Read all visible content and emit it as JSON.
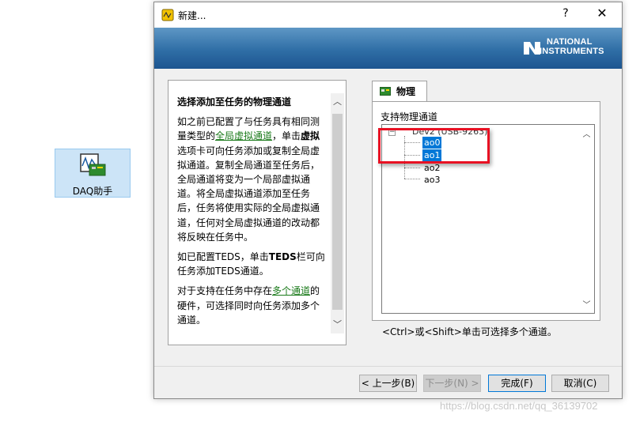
{
  "desktop": {
    "daq_label": "DAQ助手"
  },
  "dialog": {
    "title": "新建...",
    "help_glyph": "?",
    "close_glyph": "✕",
    "logo_line1": "NATIONAL",
    "logo_line2": "INSTRUMENTS"
  },
  "help_panel": {
    "heading": "选择添加至任务的物理通道",
    "p1_a": "如之前已配置了与任务具有相同测量类型的",
    "p1_link": "全局虚拟通道",
    "p1_b": "，单击",
    "p1_bold": "虚拟",
    "p1_c": "选项卡可向任务添加或复制全局虚拟通道。复制全局通道至任务后，全局通道将变为一个局部虚拟通道。将全局虚拟通道添加至任务后，任务将使用实际的全局虚拟通道，任何对全局虚拟通道的改动都将反映在任务中。",
    "p2_a": "如已配置TEDS，单击",
    "p2_bold": "TEDS",
    "p2_b": "栏可向任务添加TEDS通道。",
    "p3_a": "对于支持在任务中存在",
    "p3_link": "多个通道",
    "p3_b": "的硬件，可选择同时向任务添加多个通道。"
  },
  "tab": {
    "label": "物理"
  },
  "channels": {
    "label": "支持物理通道",
    "device": "Dev2 (USB-9263)",
    "items": [
      "ao0",
      "ao1",
      "ao2",
      "ao3"
    ],
    "selected": [
      "ao0",
      "ao1"
    ]
  },
  "hint": "<Ctrl>或<Shift>单击可选择多个通道。",
  "buttons": {
    "back": "< 上一步(B)",
    "next": "下一步(N) >",
    "finish": "完成(F)",
    "cancel": "取消(C)"
  },
  "watermark": "https://blog.csdn.net/qq_36139702"
}
